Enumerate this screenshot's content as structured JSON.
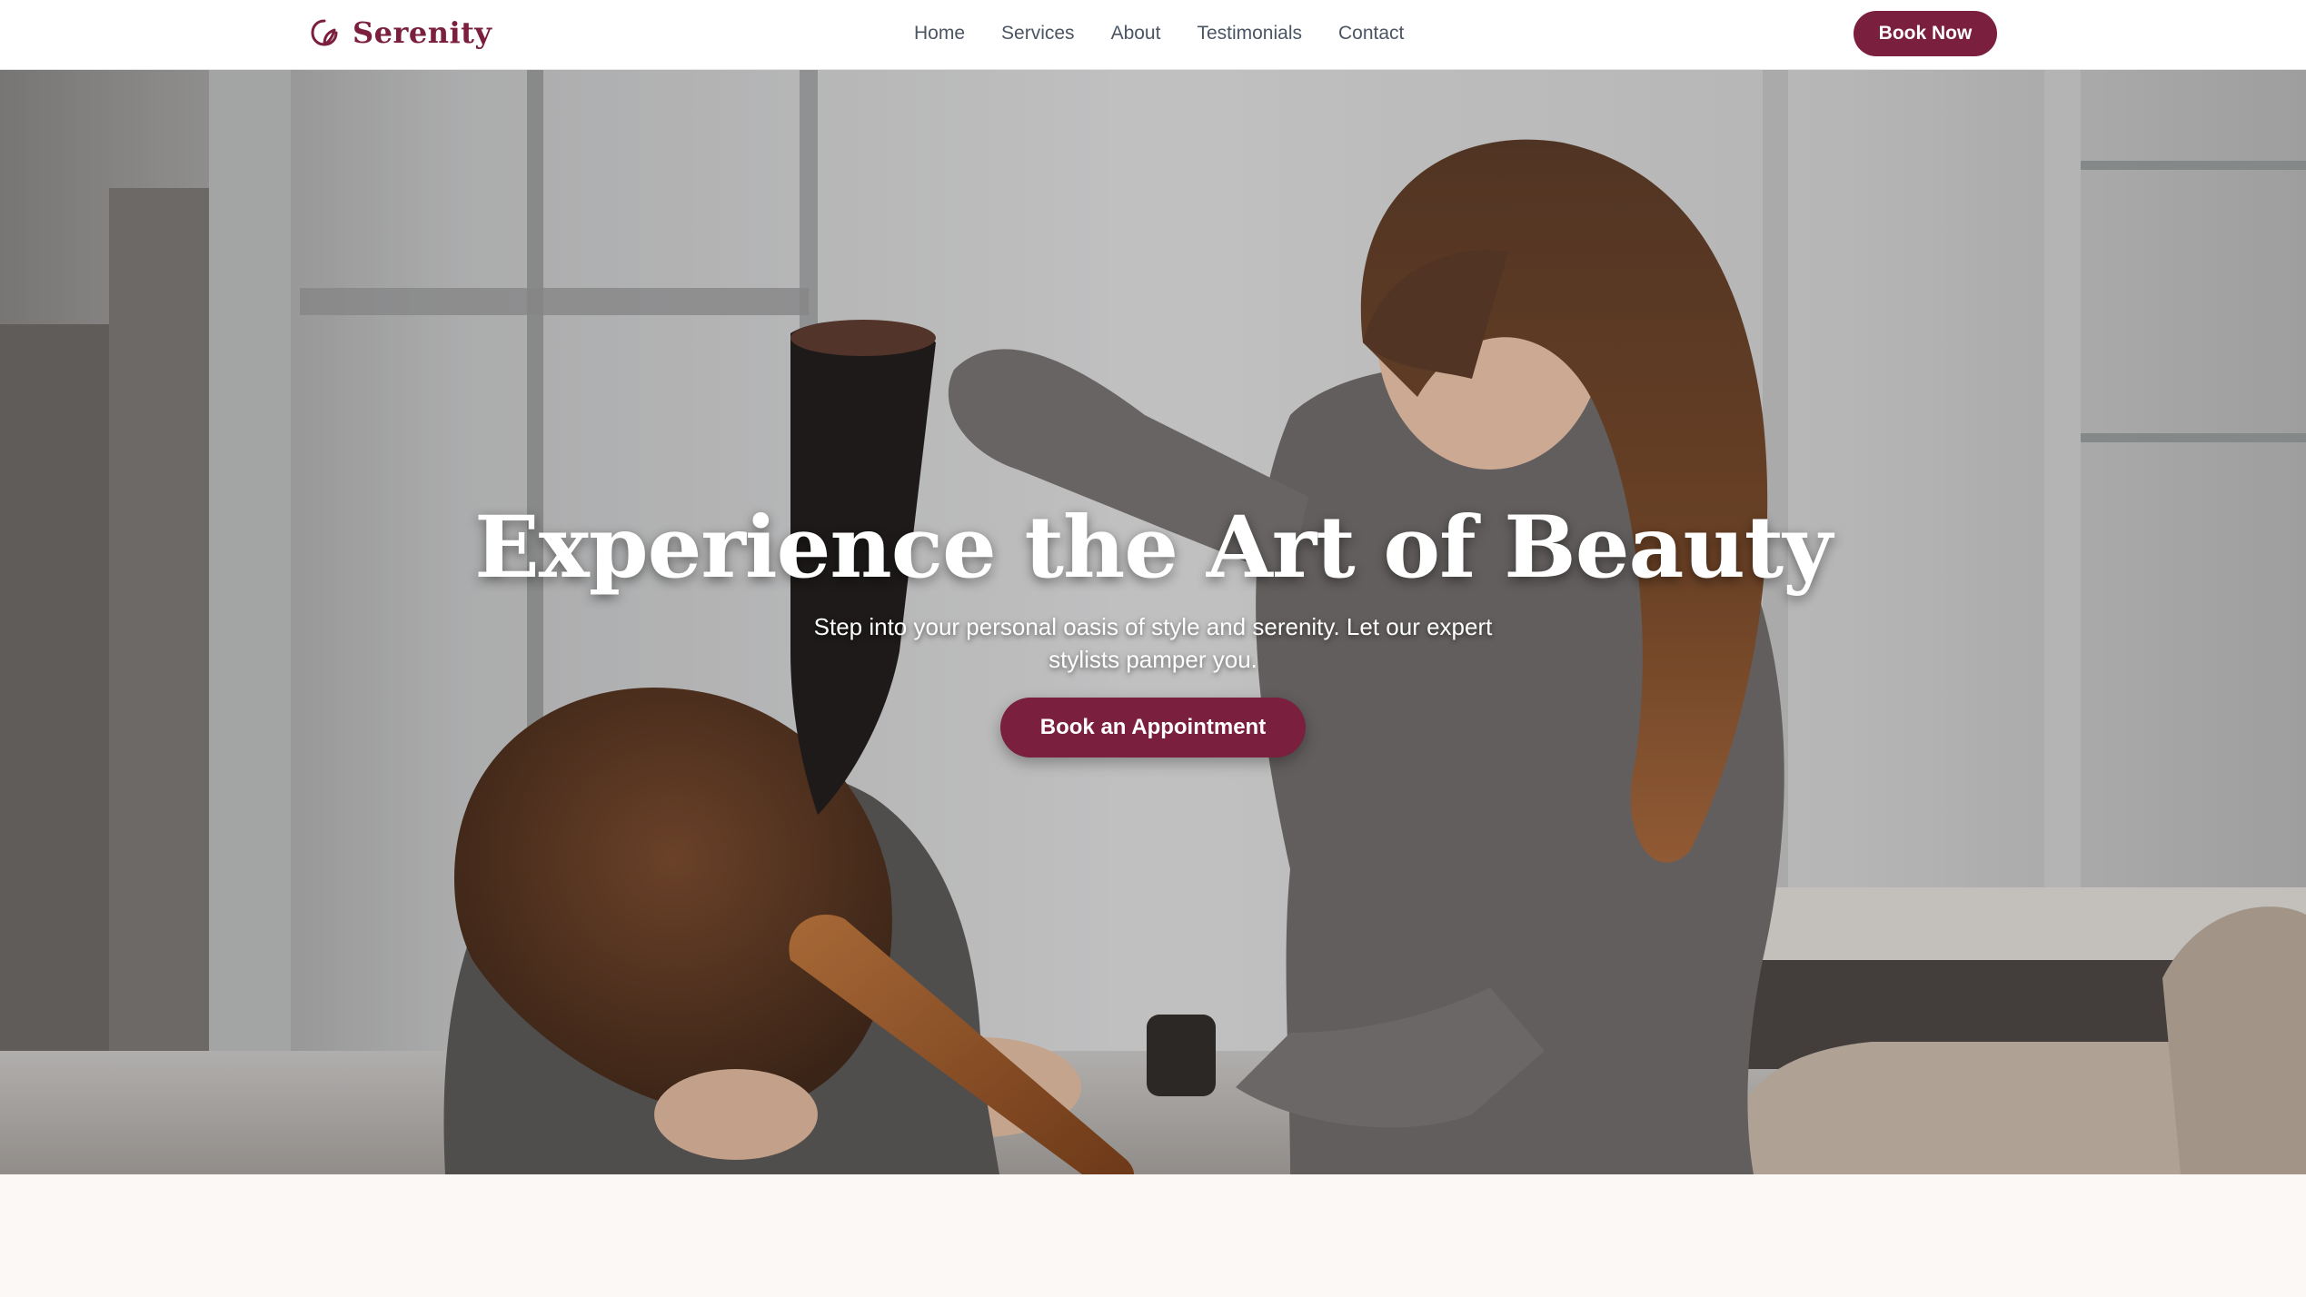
{
  "header": {
    "brand_name": "Serenity",
    "nav": [
      "Home",
      "Services",
      "About",
      "Testimonials",
      "Contact"
    ],
    "cta_label": "Book Now"
  },
  "hero": {
    "title": "Experience the Art of Beauty",
    "subtitle": "Step into your personal oasis of style and serenity. Let our expert stylists pamper you.",
    "cta_label": "Book an Appointment"
  },
  "colors": {
    "brand": "#7a1f3d",
    "nav_text": "#4b5563",
    "page_bg": "#fcf8f6"
  },
  "icons": {
    "logo": "spa-leaf-icon"
  }
}
